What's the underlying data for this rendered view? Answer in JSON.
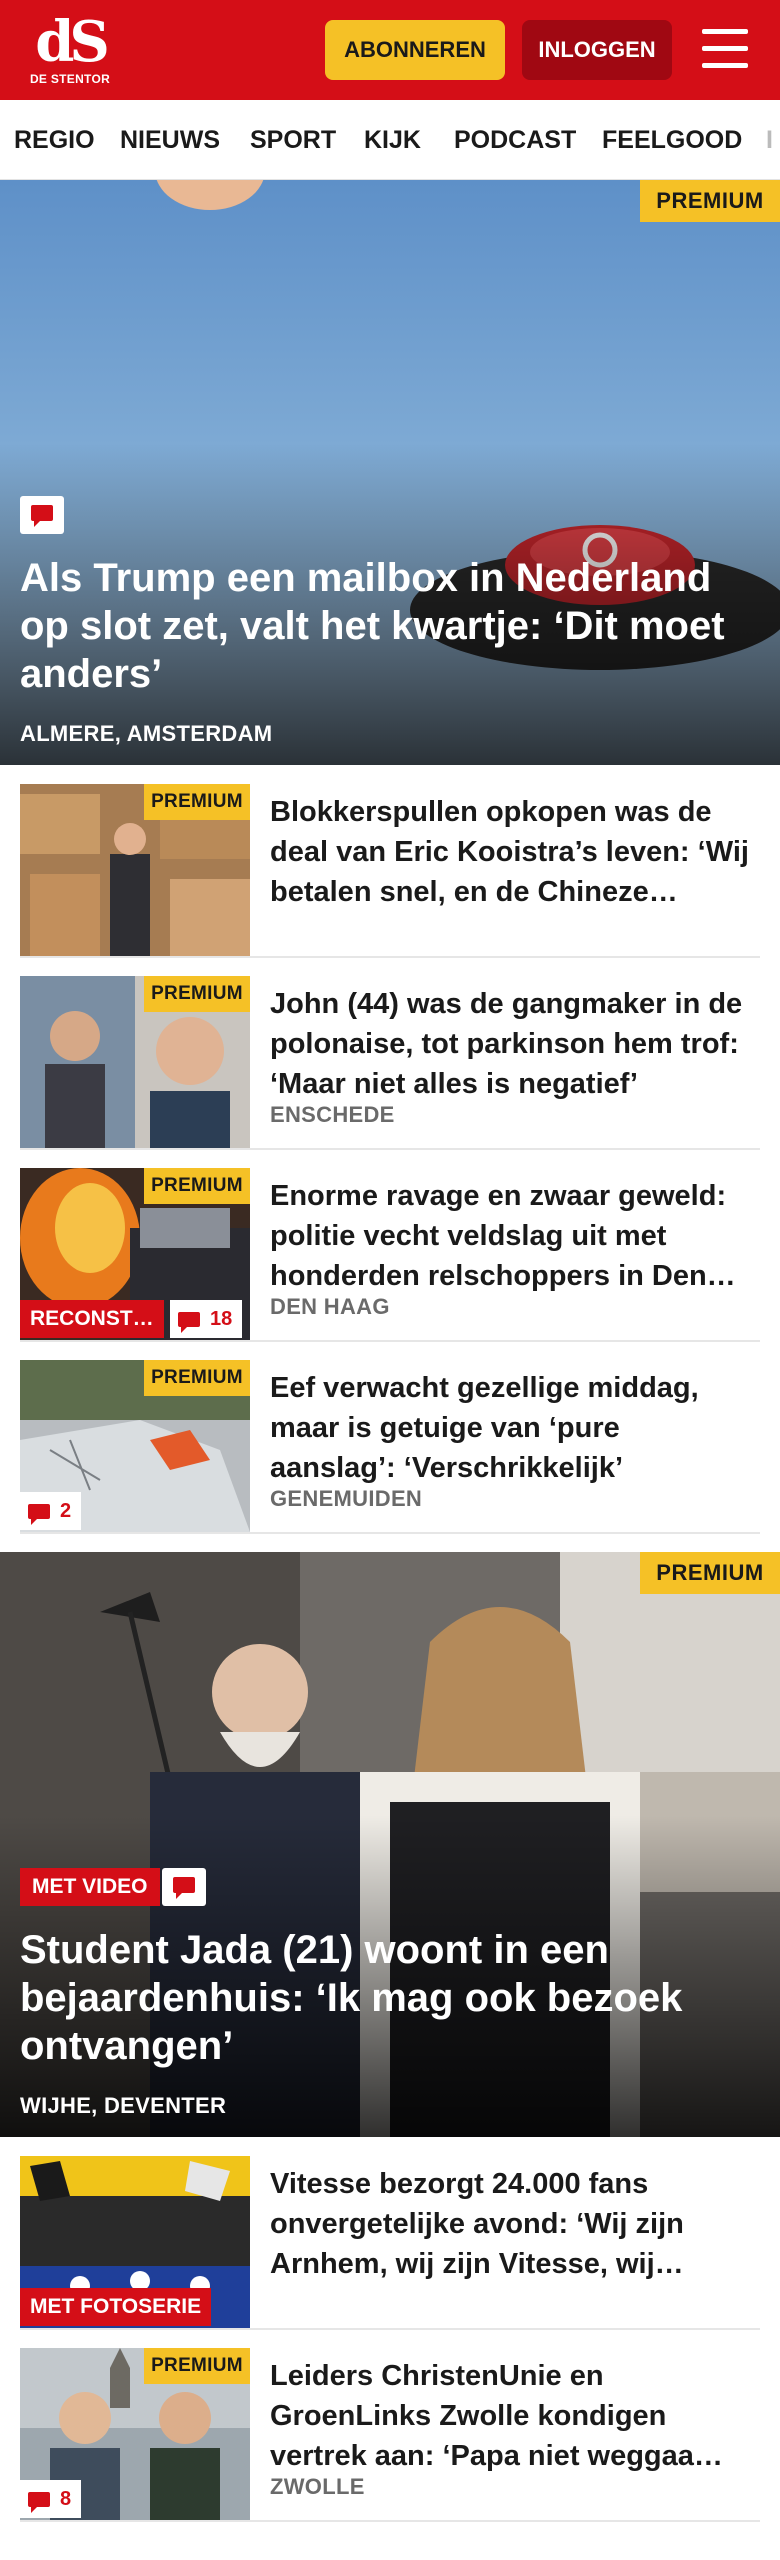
{
  "header": {
    "logo_mark": "dS",
    "logo_name": "DE STENTOR",
    "subscribe_label": "ABONNEREN",
    "login_label": "INLOGGEN",
    "brand_color": "#d40e17",
    "accent_color": "#f5c126"
  },
  "nav": {
    "items": [
      "REGIO",
      "NIEUWS",
      "SPORT",
      "KIJK",
      "PODCAST",
      "FEELGOOD",
      "I"
    ]
  },
  "hero1": {
    "premium": "PREMIUM",
    "title": "Als Trump een mailbox in Nederland op slot zet, valt het kwartje: ‘Dit moet anders’",
    "location": "ALMERE, AMSTERDAM",
    "has_comments_icon": true
  },
  "articles": [
    {
      "premium": "PREMIUM",
      "title": "Blokkerspullen opkopen was de deal van Eric Kooistra’s leven: ‘Wij betalen snel, en de Chineze…",
      "location": ""
    },
    {
      "premium": "PREMIUM",
      "title": "John (44) was de gangmaker in de polonaise, tot parkinson hem trof: ‘Maar niet alles is negatief’",
      "location": "ENSCHEDE"
    },
    {
      "premium": "PREMIUM",
      "title": "Enorme ravage en zwaar geweld: politie vecht veldslag uit met honderden relschoppers in Den…",
      "location": "DEN HAAG",
      "label": "RECONST…",
      "comments": "18"
    },
    {
      "premium": "PREMIUM",
      "title": "Eef verwacht gezellige middag, maar is getuige van ‘pure aanslag’: ‘Verschrikkelijk’",
      "location": "GENEMUIDEN",
      "comments": "2"
    }
  ],
  "hero2": {
    "premium": "PREMIUM",
    "video_label": "MET VIDEO",
    "title": "Student Jada (21) woont in een bejaardenhuis: ‘Ik mag ook bezoek ontvangen’",
    "location": "WIJHE, DEVENTER"
  },
  "articles2": [
    {
      "title": "Vitesse bezorgt 24.000 fans onvergetelijke avond: ‘Wij zijn Arnhem, wij zijn Vitesse, wij…",
      "location": "",
      "label": "MET FOTOSERIE"
    },
    {
      "premium": "PREMIUM",
      "title": "Leiders ChristenUnie en GroenLinks Zwolle kondigen vertrek aan: ‘Papa niet weggaa…",
      "location": "ZWOLLE",
      "comments": "8"
    }
  ]
}
